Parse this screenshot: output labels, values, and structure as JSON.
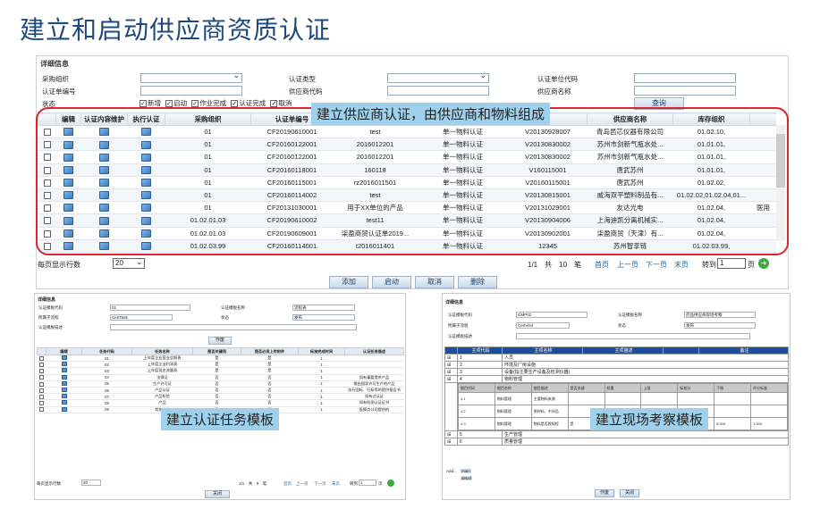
{
  "page_title": "建立和启动供应商资质认证",
  "details": {
    "section_title": "详细信息",
    "labels": {
      "purchase_org": "采购组织",
      "cert_type": "认证类型",
      "cert_unit_code": "认证单位代码",
      "cert_doc_no": "认证单编号",
      "supplier_code": "供应商代码",
      "supplier_name": "供应商名称",
      "status": "状态"
    },
    "status_options": [
      {
        "label": "新增",
        "checked": true
      },
      {
        "label": "启动",
        "checked": true
      },
      {
        "label": "作业完成",
        "checked": true
      },
      {
        "label": "认证完成",
        "checked": true
      },
      {
        "label": "取消",
        "checked": true
      }
    ],
    "query_button": "查询"
  },
  "callouts": {
    "main": "建立供应商认证，由供应商和物料组成",
    "task_template": "建立认证任务模板",
    "site_template": "建立现场考察模板"
  },
  "grid": {
    "columns": [
      "编辑",
      "认证内容维护",
      "执行认证",
      "采购组织",
      "认证单编号",
      "",
      "",
      "",
      "供应商名称",
      "库存组织",
      ""
    ],
    "rows": [
      [
        "01",
        "CF20190610001",
        "test",
        "单一物料认证",
        "V20130928007",
        "青岛邑芯仪器有限公司",
        "01.02.10,",
        ""
      ],
      [
        "01",
        "CF20160122001",
        "2016012201",
        "单一物料认证",
        "V20130830002",
        "苏州市剑新气瓶水处...",
        "01.01.01,",
        ""
      ],
      [
        "01",
        "CF20160122001",
        "2016012201",
        "单一物料认证",
        "V20130830002",
        "苏州市剑新气瓶水处...",
        "01.01.01,",
        ""
      ],
      [
        "01",
        "CF20160118001",
        "160118",
        "单一物料认证",
        "V160115001",
        "唐武苏州",
        "01.01.01,",
        ""
      ],
      [
        "01",
        "CF20160115001",
        "rz2016011501",
        "单一物料认证",
        "V20160115001",
        "唐武苏州",
        "01.02.02,",
        ""
      ],
      [
        "01",
        "CF20160114002",
        "test",
        "单一物料认证",
        "V20130815001",
        "威海双平塑料制品有...",
        "01.02.02,01.02.04,01...",
        ""
      ],
      [
        "01",
        "CF20131030001",
        "用于XX单位的产品",
        "单一物料认证",
        "V20131029001",
        "友达光电",
        "01.02.04,",
        "医用"
      ],
      [
        "01.02.01.03",
        "CF20190610002",
        "test11",
        "单一物料认证",
        "V20130904006",
        "上海迪凯分离机械实...",
        "01.02.04,",
        ""
      ],
      [
        "01.02.01.03",
        "CF20190609001",
        "柒盈商贸认证单2019...",
        "单一物料认证",
        "V20130902001",
        "柒盈商贸（天津）有...",
        "01.02.04,",
        ""
      ],
      [
        "01.02.03.99",
        "CF20160114001",
        "t2016011401",
        "单一物料认证",
        "12345",
        "苏州智享链",
        "01.02.03.99,",
        ""
      ]
    ]
  },
  "pager": {
    "rows_label": "每页显示行数",
    "rows_value": "20",
    "page_info": "1/1　共　10　笔",
    "first": "首页",
    "prev": "上一页",
    "next": "下一页",
    "last": "末页",
    "goto_label": "转到",
    "goto_value": "1",
    "page_unit": "页"
  },
  "actions": {
    "add": "添加",
    "start": "启动",
    "cancel": "取消",
    "delete": "删除"
  },
  "task_template": {
    "section_title": "详细信息",
    "labels": {
      "code": "认证模板代码",
      "name": "认证模板名称",
      "belongs": "所属子流程",
      "status": "状态",
      "desc": "认证模板描述"
    },
    "values": {
      "code": "01",
      "name": "流程表",
      "belongs": "CertTask",
      "status": "发布"
    },
    "button": "作废",
    "columns": [
      "编辑",
      "任务代码",
      "任务名称",
      "是否关键项",
      "是否必须上传附件",
      "标准完成时间",
      "认证任务描述"
    ],
    "rows": [
      [
        "01",
        "上年度企业营业总报表",
        "是",
        "是",
        "1",
        ""
      ],
      [
        "02",
        "上年度企业利润表",
        "是",
        "是",
        "1",
        ""
      ],
      [
        "03",
        "上年度现金流量表",
        "是",
        "是",
        "1",
        ""
      ],
      [
        "04",
        "法律证",
        "否",
        "否",
        "1",
        "如有事要提供产品"
      ],
      [
        "05",
        "生产许可证",
        "否",
        "否",
        "1",
        "需由国家许可生产的产品"
      ],
      [
        "06",
        "产品认证",
        "否",
        "否",
        "1",
        "执行国标、行标等的提供报告书"
      ],
      [
        "07",
        "产品检验",
        "否",
        "否",
        "1",
        "如有过认证"
      ],
      [
        "08",
        "产品",
        "否",
        "否",
        "1",
        "如有检测认证证书"
      ],
      [
        "09",
        "其他文件",
        "否",
        "否",
        "1",
        "投掷点公司提供的"
      ]
    ],
    "pager": {
      "rows_label": "每页显示行数",
      "rows_value": "20",
      "info": "1/1　共　9　笔",
      "first": "首页",
      "prev": "上一页",
      "next": "下一页",
      "last": "末页",
      "goto": "转到",
      "goto_value": "1",
      "unit": "页"
    },
    "close": "关闭"
  },
  "site_template": {
    "section_title": "详细信息",
    "labels": {
      "code": "认证模板代码",
      "name": "认证模板名称",
      "belongs": "所属子流程",
      "status": "状态",
      "desc": "认证模板描述"
    },
    "values": {
      "code": "GMP02",
      "name": "药品供应商现场考察",
      "belongs": "CertVisit",
      "status": "发布"
    },
    "header": [
      "主项代码",
      "主项名称",
      "主项描述",
      "",
      "备注"
    ],
    "items": [
      [
        "1",
        "人员"
      ],
      [
        "2",
        "环境及厂房设施"
      ],
      [
        "3",
        "设备(指主要生产设备及检测仪器)"
      ],
      [
        "4",
        "物料管理"
      ]
    ],
    "sub_header": [
      "细目代码",
      "细目名称",
      "细目描述",
      "是否关键",
      "权重",
      "上限",
      "标准分",
      "下限",
      "评分标准"
    ],
    "sub_rows": [
      [
        "4.1",
        "物料管理",
        "主要物料来源",
        "",
        "",
        "",
        "",
        "",
        ""
      ],
      [
        "4.2",
        "物料管理",
        "原材料、中间品",
        "",
        "",
        "",
        "",
        "",
        ""
      ],
      [
        "4.3",
        "物料管理",
        "物料是否按规程",
        "是",
        "1",
        "5.000",
        "0.000",
        "5.000",
        "1.000"
      ]
    ],
    "items_after": [
      [
        "5",
        "生产管理"
      ],
      [
        "6",
        "质量管理"
      ]
    ],
    "add_label": "Add...",
    "add_options": [
      "main",
      "detail"
    ],
    "buttons": {
      "void": "作废",
      "close": "关闭"
    }
  }
}
